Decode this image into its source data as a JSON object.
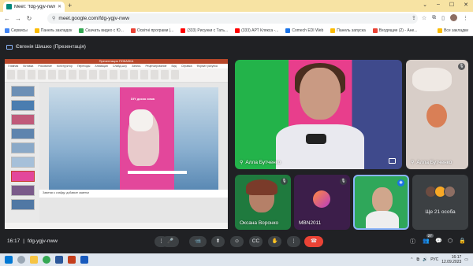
{
  "browser": {
    "tab_title": "Meet: \"fdg-ygjv-nww\"",
    "url": "meet.google.com/fdg-ygjv-nww",
    "bookmarks": [
      {
        "label": "Сервисы",
        "color": "#4285f4"
      },
      {
        "label": "Панель закладок",
        "color": "#fbbc04"
      },
      {
        "label": "Скачать видео с Ю...",
        "color": "#34a853"
      },
      {
        "label": "Освітні програми |...",
        "color": "#ea4335"
      },
      {
        "label": "(333) Рисунки с Тать...",
        "color": "#ff0000"
      },
      {
        "label": "(333) АРТ Клякса -...",
        "color": "#ff0000"
      },
      {
        "label": "Comech EDI Web",
        "color": "#1a73e8"
      },
      {
        "label": "Панель запуска",
        "color": "#fbbc04"
      },
      {
        "label": "Входящие (2) - Ане...",
        "color": "#ea4335"
      }
    ],
    "all_bookmarks": "Все закладки"
  },
  "meet": {
    "presenting_label": "Євгенія Шишко (Презентація)",
    "ppt": {
      "title": "Презентация ПОКАЗКА",
      "ribbon_tabs": [
        "Главная",
        "Вставка",
        "Рисование",
        "Конструктор",
        "Переходы",
        "Анимация",
        "Слайд-шоу",
        "Запись",
        "Рецензирование",
        "Вид",
        "Справка",
        "Формат рисунка"
      ],
      "slide_title": "DIY диско зима",
      "notes": "Заметки к слайду: добавьте заметки"
    },
    "tiles": {
      "main_name": "Алла Бутченко",
      "right_name": "Алла Бутченко",
      "oks_name": "Оксана Воронко",
      "mbn_name": "MBN2011",
      "more_label": "Ще 21 особа"
    }
  },
  "controls": {
    "time": "16:17",
    "meeting_code": "fdg-ygjv-nww",
    "buttons": [
      "⋮",
      "🎤",
      "📹",
      "⬆",
      "☺",
      "CC",
      "✋",
      "☎"
    ],
    "people_count": "27"
  },
  "taskbar": {
    "lang": "РУС",
    "time": "16:17",
    "date": "12.09.2023"
  },
  "colors": {
    "accent": "#8ab4f8",
    "end_call": "#ea4335",
    "meet_bg": "#202124"
  }
}
